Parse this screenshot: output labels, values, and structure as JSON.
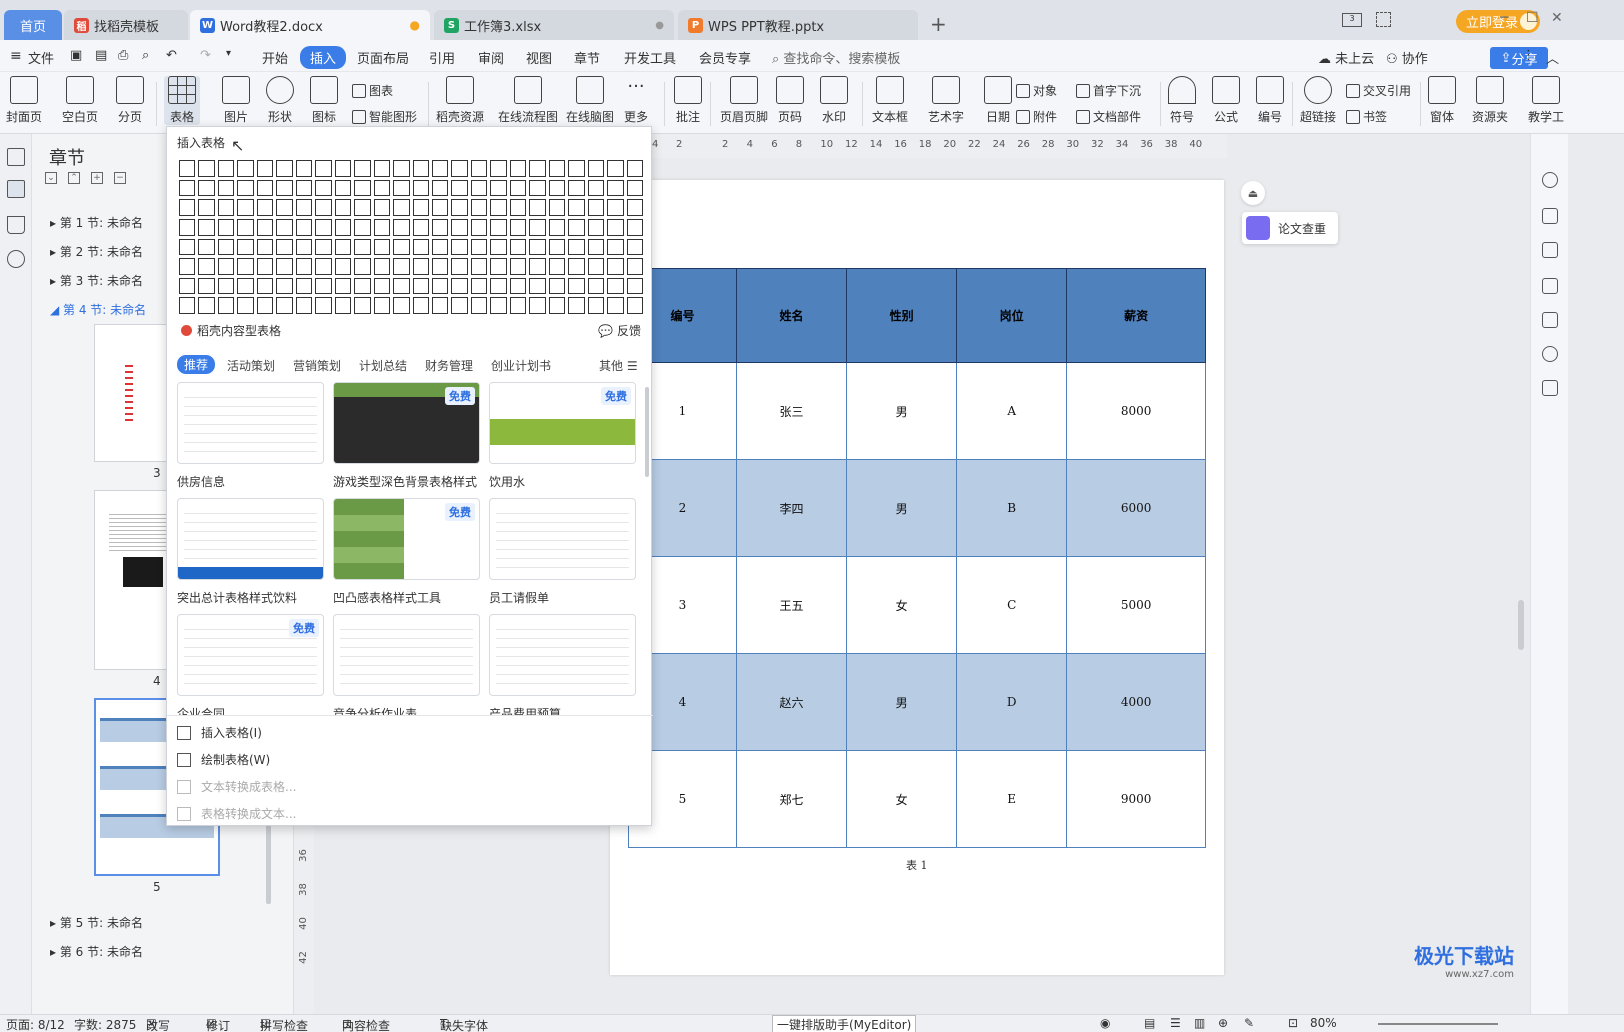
{
  "titlebar": {
    "tabs": [
      {
        "label": "首页",
        "icon": "home",
        "color": "#5a8fe6"
      },
      {
        "label": "找稻壳模板",
        "icon": "docer-icon",
        "color": "#e04a3a"
      },
      {
        "label": "Word教程2.docx",
        "icon": "word-icon",
        "color": "#2f6fe0"
      },
      {
        "label": "工作簿3.xlsx",
        "icon": "excel-icon",
        "color": "#1fa463"
      },
      {
        "label": "WPS PPT教程.pptx",
        "icon": "ppt-icon",
        "color": "#f07b2d"
      }
    ],
    "new_tab": "+",
    "login_label": "立即登录"
  },
  "menubar": {
    "file": "文件",
    "items": [
      "开始",
      "插入",
      "页面布局",
      "引用",
      "审阅",
      "视图",
      "章节",
      "开发工具",
      "会员专享"
    ],
    "active": "插入",
    "search_placeholder": "查找命令、搜索模板",
    "cloud": "未上云",
    "collab": "协作",
    "share": "分享"
  },
  "ribbon": {
    "big": [
      "封面页",
      "空白页",
      "分页",
      "表格",
      "图片",
      "形状",
      "图标",
      "稻壳资源",
      "在线流程图",
      "在线脑图",
      "更多",
      "批注",
      "页眉页脚",
      "页码",
      "水印",
      "文本框",
      "艺术字",
      "日期",
      "符号",
      "公式",
      "编号",
      "超链接",
      "窗体",
      "资源夹",
      "教学工"
    ],
    "small": [
      "图表",
      "智能图形",
      "对象",
      "附件",
      "首字下沉",
      "文档部件",
      "交叉引用",
      "书签"
    ]
  },
  "chapter_panel": {
    "title": "章节",
    "sections": [
      "第 1 节: 未命名",
      "第 2 节: 未命名",
      "第 3 节: 未命名",
      "第 4 节: 未命名",
      "第 5 节: 未命名",
      "第 6 节: 未命名"
    ],
    "page_numbers": [
      "3",
      "4",
      "5"
    ]
  },
  "insert_table_popup": {
    "title": "插入表格",
    "grid_cols": 24,
    "grid_rows": 8,
    "docer_label": "稻壳内容型表格",
    "feedback": "反馈",
    "categories": [
      "推荐",
      "活动策划",
      "营销策划",
      "计划总结",
      "财务管理",
      "创业计划书",
      "其他"
    ],
    "free_badge": "免费",
    "templates": [
      {
        "name": "供房信息",
        "free": false
      },
      {
        "name": "游戏类型深色背景表格样式",
        "free": true
      },
      {
        "name": "饮用水",
        "free": true
      },
      {
        "name": "突出总计表格样式饮料",
        "free": false
      },
      {
        "name": "凹凸感表格样式工具",
        "free": true
      },
      {
        "name": "员工请假单",
        "free": false
      },
      {
        "name": "企业合同",
        "free": true
      },
      {
        "name": "竞争分析作业表",
        "free": false
      },
      {
        "name": "产品费用预算",
        "free": false
      }
    ],
    "actions": [
      {
        "label": "插入表格(I)",
        "enabled": true
      },
      {
        "label": "绘制表格(W)",
        "enabled": true
      },
      {
        "label": "文本转换成表格...",
        "enabled": false
      },
      {
        "label": "表格转换成文本...",
        "enabled": false
      }
    ]
  },
  "ruler": {
    "h_ticks": [
      "4",
      "2",
      "2",
      "4",
      "6",
      "8",
      "10",
      "12",
      "14",
      "16",
      "18",
      "20",
      "22",
      "24",
      "26",
      "28",
      "30",
      "32",
      "34",
      "36",
      "38",
      "40"
    ],
    "v_ticks": [
      "36",
      "38",
      "40",
      "42"
    ]
  },
  "document": {
    "table": {
      "headers": [
        "编号",
        "姓名",
        "性别",
        "岗位",
        "薪资"
      ],
      "rows": [
        [
          "1",
          "张三",
          "男",
          "A",
          "8000"
        ],
        [
          "2",
          "李四",
          "男",
          "B",
          "6000"
        ],
        [
          "3",
          "王五",
          "女",
          "C",
          "5000"
        ],
        [
          "4",
          "赵六",
          "男",
          "D",
          "4000"
        ],
        [
          "5",
          "郑七",
          "女",
          "E",
          "9000"
        ]
      ],
      "header_color": "#4f81bd",
      "alt_color": "#b8cce4"
    },
    "caption": "表 1"
  },
  "right_panel": {
    "paper_check": "论文查重"
  },
  "statusbar": {
    "page": "页面: 8/12",
    "words": "字数: 2875",
    "rewrite": "改写",
    "revise": "修订",
    "spell": "拼写检查",
    "content_check": "内容检查",
    "missing_font": "缺失字体",
    "assistant": "一键排版助手(MyEditor)",
    "zoom": "80%"
  },
  "watermark": {
    "text": "极光下载站",
    "url": "www.xz7.com"
  }
}
